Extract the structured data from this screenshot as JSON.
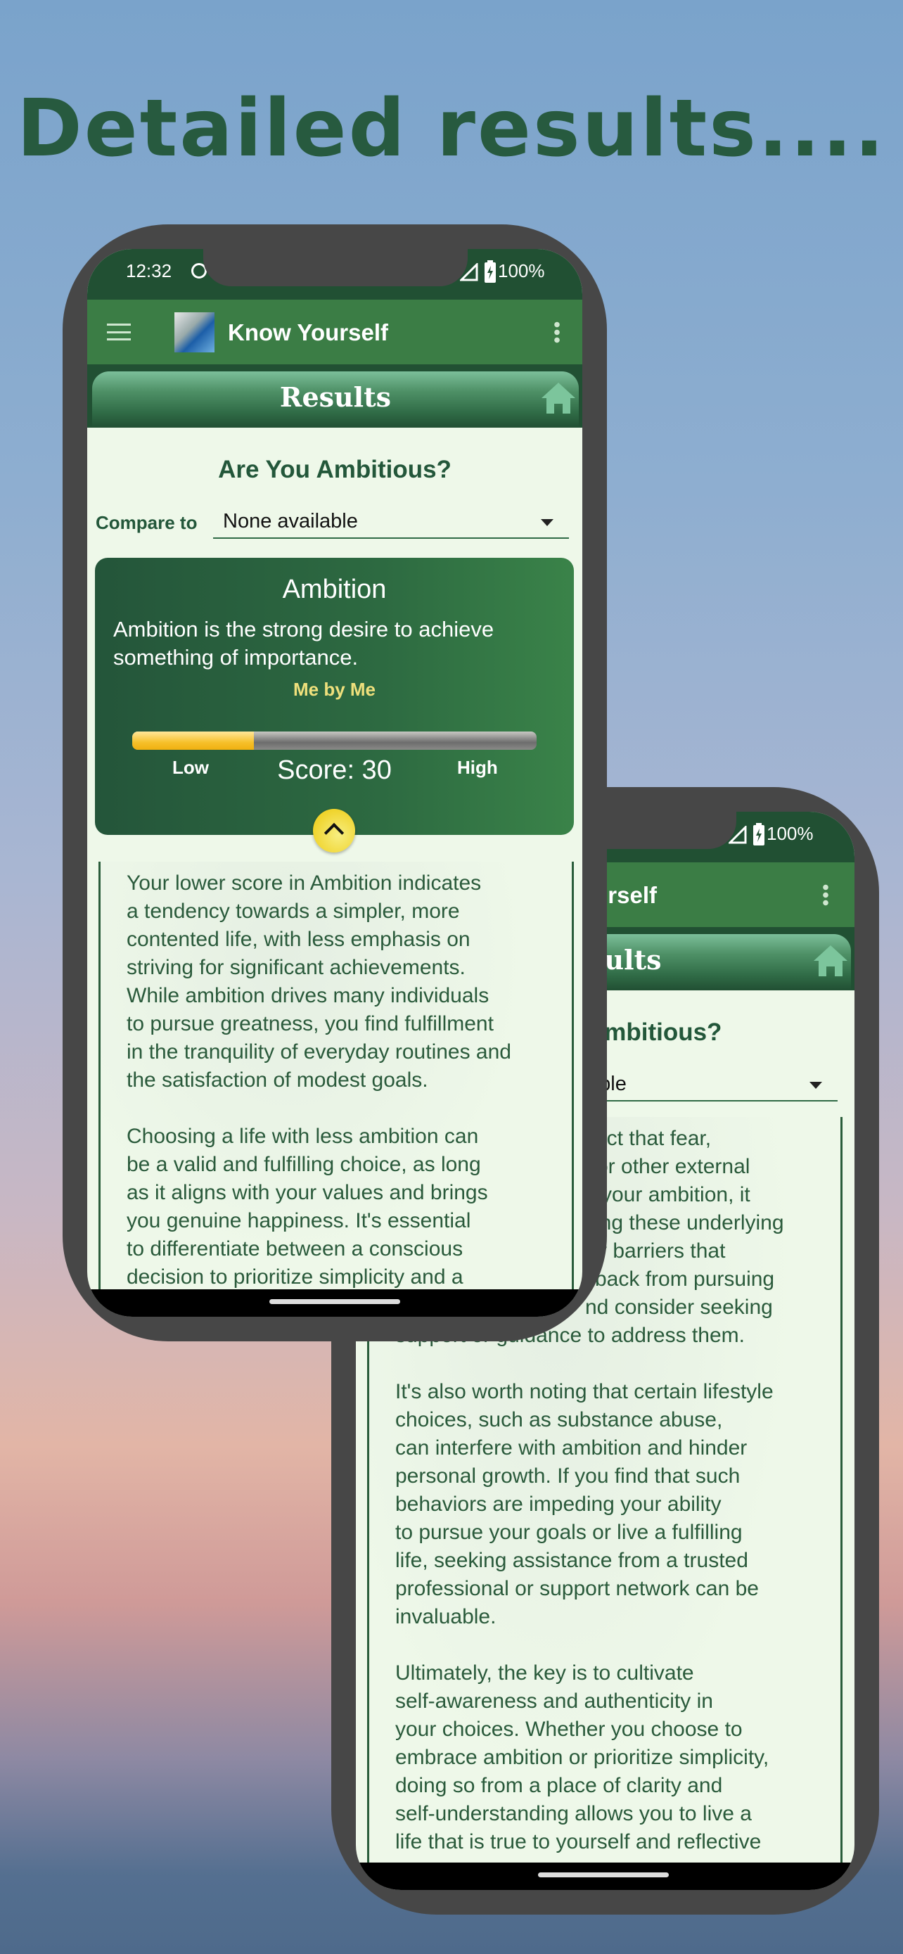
{
  "headline": "Detailed results....",
  "status": {
    "time": "12:32",
    "battery": "100%"
  },
  "app": {
    "title": "Know Yourself",
    "banner": "Results"
  },
  "page": {
    "question": "Are You Ambitious?",
    "compare_label": "Compare to",
    "compare_value": "None available"
  },
  "card": {
    "title": "Ambition",
    "description": "Ambition is the strong desire to achieve something of importance.",
    "subtitle": "Me by Me",
    "low_label": "Low",
    "high_label": "High",
    "score_label": "Score: 30",
    "score_percent": 30,
    "colors": {
      "fill": "#f6c02a",
      "card": "#2d6a41",
      "accent_text": "#efe07c"
    }
  },
  "front_text": [
    "Your lower score in Ambition indicates",
    "a tendency towards a simpler, more",
    "contented life, with less emphasis on",
    "striving for significant achievements.",
    "While ambition drives many individuals",
    "to pursue greatness, you find fulfillment",
    "in the tranquility of everyday routines and",
    "the satisfaction of modest goals.",
    "",
    "Choosing a life with less ambition can",
    "be a valid and fulfilling choice, as long",
    "as it aligns with your values and brings",
    "you genuine happiness. It's essential",
    "to differentiate between a conscious",
    "decision to prioritize simplicity and a"
  ],
  "back_fragments": [
    "ect that fear,",
    "or other external",
    "your ambition, it",
    "ing these underlying",
    "y barriers that",
    "back from pursuing",
    "nd consider seeking"
  ],
  "back_text": [
    "support or guidance to address them.",
    "",
    "It's also worth noting that certain lifestyle",
    "choices, such as substance abuse,",
    "can interfere with ambition and hinder",
    "personal growth. If you find that such",
    "behaviors are impeding your ability",
    "to pursue your goals or live a fulfilling",
    "life, seeking assistance from a trusted",
    "professional or support network can be",
    "invaluable.",
    "",
    "Ultimately, the key is to cultivate",
    "self-awareness and authenticity in",
    "your choices. Whether you choose to",
    "embrace ambition or prioritize simplicity,",
    "doing so from a place of clarity and",
    "self-understanding allows you to live a",
    "life that is true to yourself and reflective"
  ],
  "icons": [
    "menu-icon",
    "app-logo",
    "more-vert-icon",
    "home-icon",
    "dropdown-arrow-icon",
    "chevron-up-icon",
    "signal-icon",
    "battery-charging-icon"
  ]
}
